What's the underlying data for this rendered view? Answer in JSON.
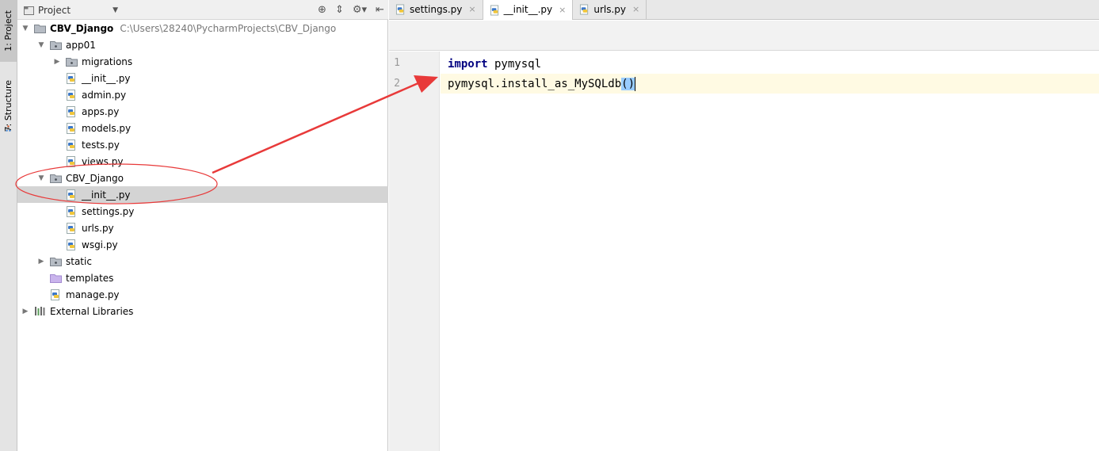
{
  "left_strip": {
    "project_tab": "1: Project",
    "structure_tab": "7: Structure"
  },
  "project_panel": {
    "title": "Project"
  },
  "tree": [
    {
      "depth": 0,
      "arrow": "down",
      "icon": "project-folder-icon",
      "label": "CBV_Django",
      "bold": true,
      "path": "C:\\Users\\28240\\PycharmProjects\\CBV_Django"
    },
    {
      "depth": 1,
      "arrow": "down",
      "icon": "package-folder-icon",
      "label": "app01"
    },
    {
      "depth": 2,
      "arrow": "right",
      "icon": "package-folder-icon",
      "label": "migrations"
    },
    {
      "depth": 2,
      "arrow": "",
      "icon": "python-file-icon",
      "label": "__init__.py"
    },
    {
      "depth": 2,
      "arrow": "",
      "icon": "python-file-icon",
      "label": "admin.py"
    },
    {
      "depth": 2,
      "arrow": "",
      "icon": "python-file-icon",
      "label": "apps.py"
    },
    {
      "depth": 2,
      "arrow": "",
      "icon": "python-file-icon",
      "label": "models.py"
    },
    {
      "depth": 2,
      "arrow": "",
      "icon": "python-file-icon",
      "label": "tests.py"
    },
    {
      "depth": 2,
      "arrow": "",
      "icon": "python-file-icon",
      "label": "views.py"
    },
    {
      "depth": 1,
      "arrow": "down",
      "icon": "package-folder-icon",
      "label": "CBV_Django"
    },
    {
      "depth": 2,
      "arrow": "",
      "icon": "python-file-icon",
      "label": "__init__.py",
      "selected": true
    },
    {
      "depth": 2,
      "arrow": "",
      "icon": "python-file-icon",
      "label": "settings.py"
    },
    {
      "depth": 2,
      "arrow": "",
      "icon": "python-file-icon",
      "label": "urls.py"
    },
    {
      "depth": 2,
      "arrow": "",
      "icon": "python-file-icon",
      "label": "wsgi.py"
    },
    {
      "depth": 1,
      "arrow": "right",
      "icon": "package-folder-icon",
      "label": "static"
    },
    {
      "depth": 1,
      "arrow": "",
      "icon": "template-folder-icon",
      "label": "templates"
    },
    {
      "depth": 1,
      "arrow": "",
      "icon": "python-file-icon",
      "label": "manage.py"
    },
    {
      "depth": 0,
      "arrow": "right",
      "icon": "library-icon",
      "label": "External Libraries"
    }
  ],
  "editor": {
    "tabs": [
      {
        "label": "settings.py",
        "active": false,
        "close": "×"
      },
      {
        "label": "__init__.py",
        "active": true,
        "close": "×"
      },
      {
        "label": "urls.py",
        "active": false,
        "close": "×"
      }
    ],
    "line_numbers": [
      "1",
      "2"
    ],
    "code": {
      "line1_keyword": "import",
      "line1_rest": " pymysql",
      "line2_text": "pymysql.install_as_MySQLdb",
      "line2_parens": "()"
    }
  },
  "colors": {
    "annotation": "#e83a3a",
    "keyword": "#000080",
    "selection": "#d4d4d4",
    "current_line": "#fffae3",
    "brace_match": "#99ccff"
  }
}
